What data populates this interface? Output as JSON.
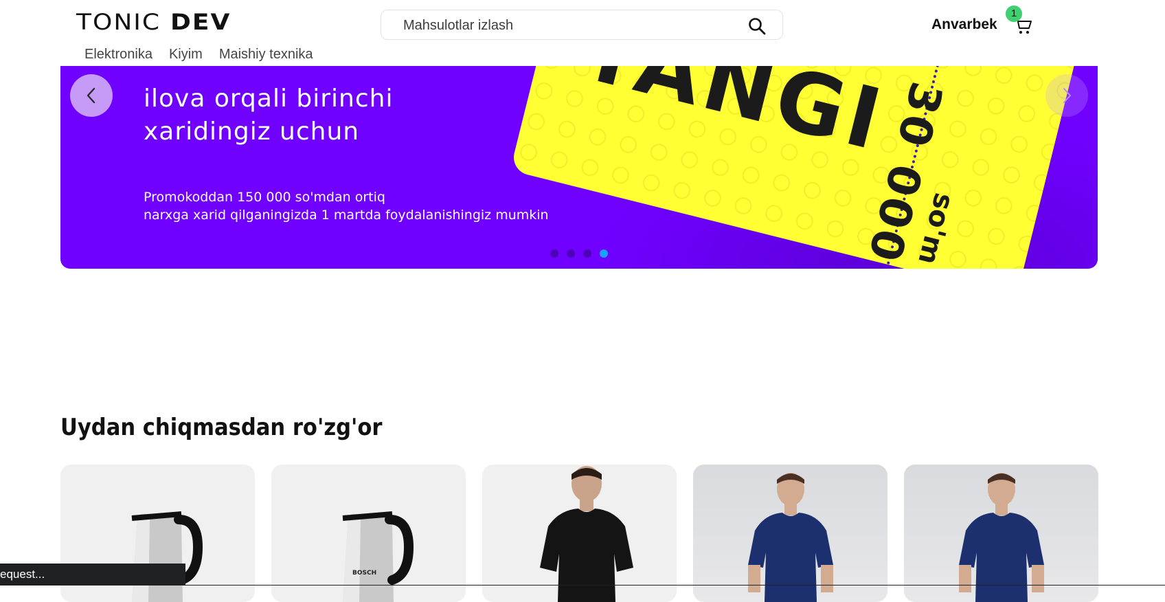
{
  "header": {
    "logo_part1": "TONIC",
    "logo_part2": "DEV",
    "search_placeholder": "Mahsulotlar izlash",
    "user_name": "Anvarbek",
    "cart_count": "1"
  },
  "nav": {
    "items": [
      {
        "label": "Elektronika"
      },
      {
        "label": "Kiyim"
      },
      {
        "label": "Maishiy texnika"
      }
    ]
  },
  "banner": {
    "headline_line1": "ilova orqali birinchi",
    "headline_line2": "xaridingiz uchun",
    "promo_line1": "Promokoddan 150 000 so'mdan ortiq",
    "promo_line2": "narxga xarid qilganingizda 1 martda foydalanishingiz mumkin",
    "coupon_word": "YANGI",
    "coupon_amount": "30 000",
    "coupon_unit": "so'm",
    "slides_total": 4,
    "active_slide": 4,
    "colors": {
      "background": "#7000ff",
      "coupon": "#ffff33"
    }
  },
  "section": {
    "title": "Uydan chiqmasdan ro'zg'or",
    "products": [
      {
        "kind": "kettle",
        "brand_text": ""
      },
      {
        "kind": "kettle",
        "brand_text": "BOSCH"
      },
      {
        "kind": "tshirt-black"
      },
      {
        "kind": "tshirt-navy"
      },
      {
        "kind": "tshirt-navy"
      }
    ]
  },
  "status": {
    "text": "equest..."
  }
}
